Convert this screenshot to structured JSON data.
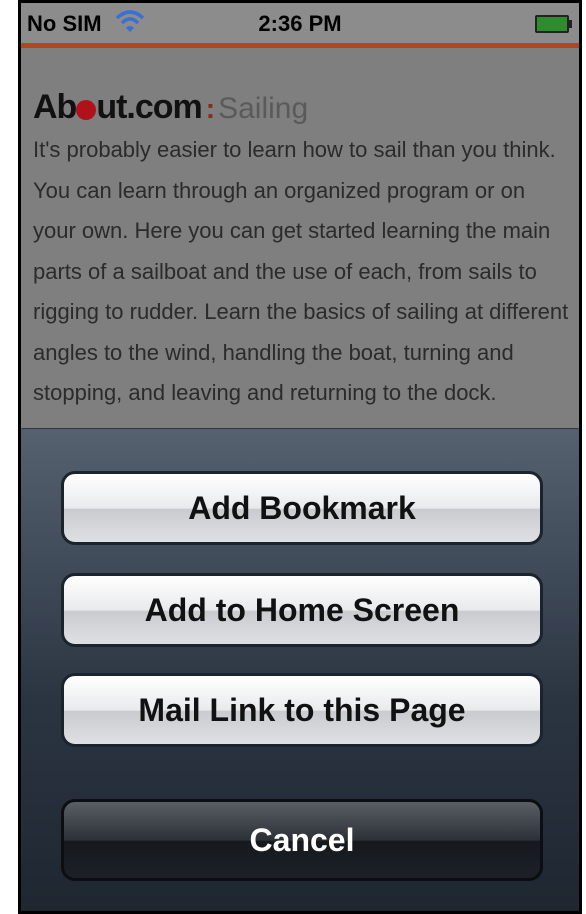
{
  "status_bar": {
    "carrier": "No SIM",
    "time": "2:36 PM",
    "icon_wifi": "wifi-icon",
    "icon_battery": "battery-icon"
  },
  "site": {
    "logo": "About.com",
    "section": "Sailing"
  },
  "article": {
    "text": "It's probably easier to learn how to sail than you think. You can learn through an organized program or on your own. Here you can get started learning the main parts of a sailboat and the use of each, from sails to rigging to rudder. Learn the basics of sailing at different angles to the wind, handling the boat, turning and stopping, and leaving and returning to the dock."
  },
  "action_sheet": {
    "add_bookmark": "Add Bookmark",
    "add_home": "Add to Home Screen",
    "mail_link": "Mail Link to this Page",
    "cancel": "Cancel"
  },
  "colors": {
    "accent": "#b4461f",
    "logo_dot": "#b0121b",
    "sheet_top": "#566170",
    "sheet_bottom": "#1e2630"
  }
}
